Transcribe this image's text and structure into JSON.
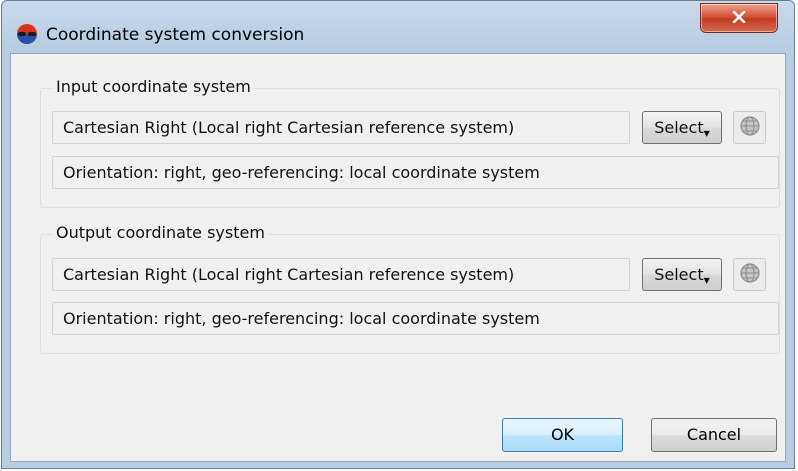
{
  "window": {
    "title": "Coordinate system conversion",
    "close_label": "X"
  },
  "input_group": {
    "title": "Input coordinate system",
    "system_value": "Cartesian Right (Local right Cartesian reference system)",
    "select_label": "Select",
    "info": "Orientation: right, geo-referencing: local coordinate system"
  },
  "output_group": {
    "title": "Output coordinate system",
    "system_value": "Cartesian Right (Local right Cartesian reference system)",
    "select_label": "Select",
    "info": "Orientation: right, geo-referencing: local coordinate system"
  },
  "buttons": {
    "ok_label": "OK",
    "cancel_label": "Cancel"
  },
  "icons": {
    "app": "app-logo-icon",
    "close": "close-icon",
    "dropdown": "dropdown-arrow-icon",
    "globe": "globe-icon"
  },
  "colors": {
    "title_bar": "#c8d9ea",
    "close_button": "#d5482d",
    "dialog_background": "#f0f0f0",
    "ok_button_border": "#3c7fb1"
  }
}
